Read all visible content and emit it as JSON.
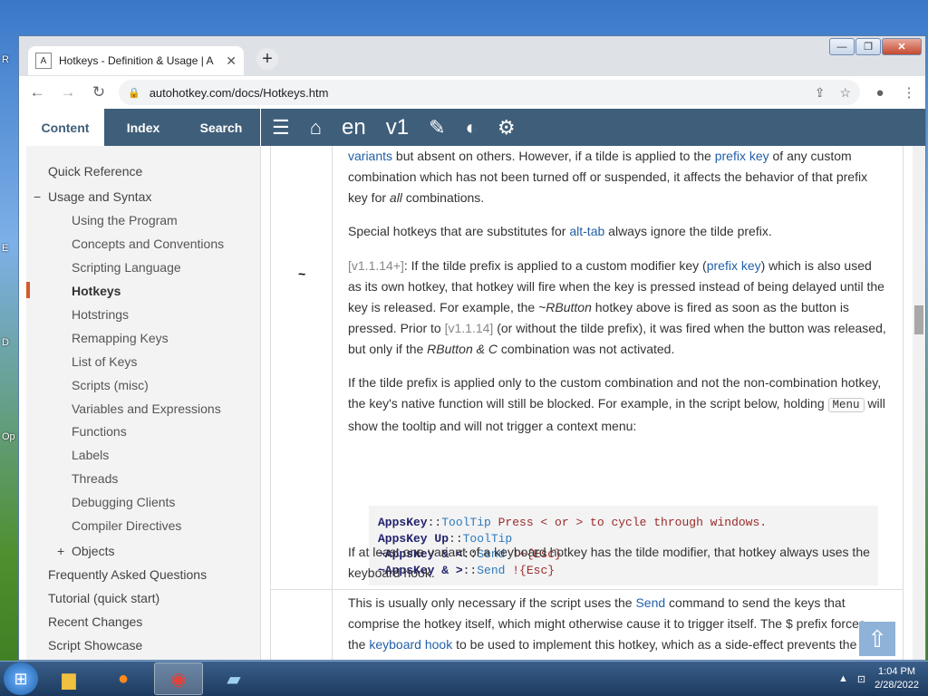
{
  "browser": {
    "tab_title": "Hotkeys - Definition & Usage | A",
    "tab_favicon": "A",
    "url": "autohotkey.com/docs/Hotkeys.htm"
  },
  "header": {
    "tabs": [
      "Content",
      "Index",
      "Search"
    ],
    "lang": "en",
    "version": "v1"
  },
  "sidebar": {
    "items": [
      {
        "label": "Quick Reference"
      },
      {
        "label": "Usage and Syntax",
        "prefix": "−"
      },
      {
        "label": "Using the Program"
      },
      {
        "label": "Concepts and Conventions"
      },
      {
        "label": "Scripting Language"
      },
      {
        "label": "Hotkeys"
      },
      {
        "label": "Hotstrings"
      },
      {
        "label": "Remapping Keys"
      },
      {
        "label": "List of Keys"
      },
      {
        "label": "Scripts (misc)"
      },
      {
        "label": "Variables and Expressions"
      },
      {
        "label": "Functions"
      },
      {
        "label": "Labels"
      },
      {
        "label": "Threads"
      },
      {
        "label": "Debugging Clients"
      },
      {
        "label": "Compiler Directives"
      },
      {
        "label": "Objects",
        "prefix": "+"
      },
      {
        "label": "Frequently Asked Questions"
      },
      {
        "label": "Tutorial (quick start)"
      },
      {
        "label": "Recent Changes"
      },
      {
        "label": "Script Showcase"
      }
    ]
  },
  "content": {
    "tilde_symbol": "~",
    "p1": {
      "a": "variants",
      "b": " but absent on others. However, if a tilde is applied to the ",
      "c": "prefix key",
      "d": " of any custom combination which has not been turned off or suspended, it affects the behavior of that prefix key for ",
      "e": "all",
      "f": " combinations."
    },
    "p2": {
      "a": "Special hotkeys that are substitutes for ",
      "b": "alt-tab",
      "c": " always ignore the tilde prefix."
    },
    "p3": {
      "v1": "[v1.1.14+]",
      "a": ": If the tilde prefix is applied to a custom modifier key (",
      "b": "prefix key",
      "c": ") which is also used as its own hotkey, that hotkey will fire when the key is pressed instead of being delayed until the key is released. For example, the ",
      "d": "~RButton",
      "e": " hotkey above is fired as soon as the button is pressed. Prior to ",
      "v2": "[v1.1.14]",
      "f": " (or without the tilde prefix), it was fired when the button was released, but only if the ",
      "g": "RButton & C",
      "h": " combination was not activated."
    },
    "p4": {
      "a": "If the tilde prefix is applied only to the custom combination and not the non-combination hotkey, the key's native function will still be blocked. For example, in the script below, holding ",
      "kbd": "Menu",
      "b": " will show the tooltip and will not trigger a context menu:"
    },
    "code": {
      "l1a": "AppsKey",
      "l1b": "::",
      "l1c": "ToolTip",
      "l1d": " Press < or > to cycle through windows.",
      "l2a": "AppsKey Up",
      "l2b": "::",
      "l2c": "ToolTip",
      "l3a": "~AppsKey & <",
      "l3b": "::",
      "l3c": "Send",
      "l3d": " !+{Esc}",
      "l4a": "~AppsKey & >",
      "l4b": "::",
      "l4c": "Send",
      "l4d": " !{Esc}"
    },
    "p5": "If at least one variant of a keyboard hotkey has the tilde modifier, that hotkey always uses the keyboard hook.",
    "p6": {
      "a": "This is usually only necessary if the script uses the ",
      "b": "Send",
      "c": " command to send the keys that comprise the hotkey itself, which might otherwise cause it to trigger itself. The $ prefix forces the ",
      "d": "keyboard hook",
      "e": " to be used to implement this hotkey, which as a side-effect prevents the"
    }
  },
  "taskbar": {
    "time": "1:04 PM",
    "date": "2/28/2022"
  }
}
